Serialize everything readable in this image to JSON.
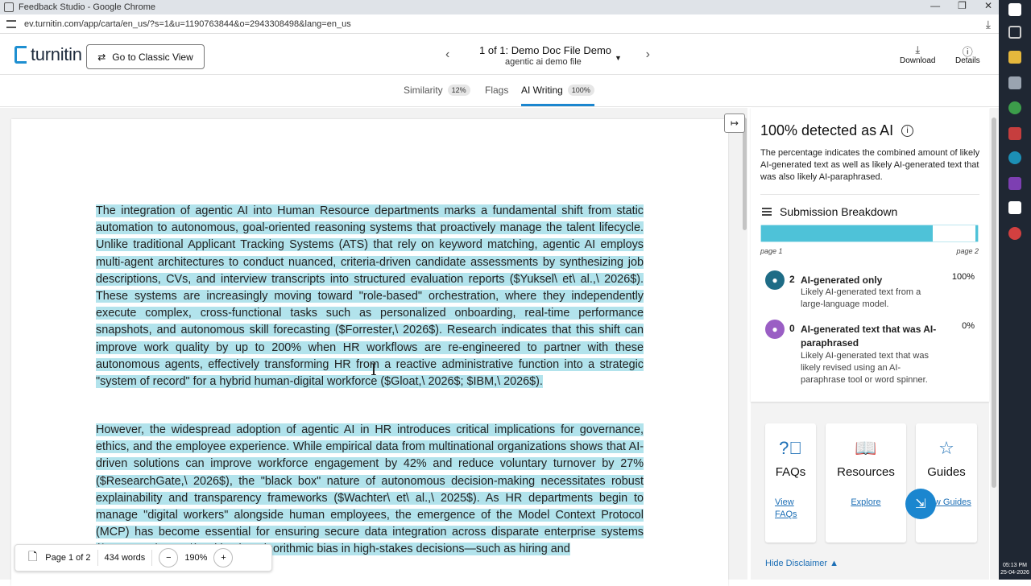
{
  "window": {
    "title": "Feedback Studio - Google Chrome",
    "url": "ev.turnitin.com/app/carta/en_us/?s=1&u=1190763844&o=2943308498&lang=en_us"
  },
  "header": {
    "logo": "turnitin",
    "classic_label": "Go to Classic View",
    "doc_title": "1 of 1: Demo Doc File Demo",
    "doc_subtitle": "agentic ai demo file",
    "download_label": "Download",
    "details_label": "Details"
  },
  "tabs": [
    {
      "label": "Similarity",
      "badge": "12%"
    },
    {
      "label": "Flags",
      "badge": ""
    },
    {
      "label": "AI Writing",
      "badge": "100%"
    }
  ],
  "document": {
    "para1": "The integration of agentic AI into Human Resource departments marks a fundamental shift from static automation to autonomous, goal-oriented reasoning systems that proactively manage the talent lifecycle. Unlike traditional Applicant Tracking Systems (ATS) that rely on keyword matching, agentic AI employs multi-agent architectures to conduct nuanced, criteria-driven candidate assessments by synthesizing job descriptions, CVs, and interview transcripts into structured evaluation reports ($Yuksel\\ et\\ al.,\\ 2026$). These systems are increasingly moving toward \"role-based\" orchestration, where they independently execute complex, cross-functional tasks such as personalized onboarding, real-time performance snapshots, and autonomous skill forecasting ($Forrester,\\ 2026$). Research indicates that this shift can improve work quality by up to 200% when HR workflows are re-engineered to partner with these autonomous agents, effectively transforming HR from a reactive administrative function into a strategic \"system of record\" for a hybrid human-digital workforce ($Gloat,\\ 2026$; $IBM,\\ 2026$).",
    "para2": "However, the widespread adoption of agentic AI in HR introduces critical implications for governance, ethics, and the employee experience. While empirical data from multinational organizations shows that AI-driven solutions can improve workforce engagement by 42% and reduce voluntary turnover by 27% ($ResearchGate,\\ 2026$), the \"black box\" nature of autonomous decision-making necessitates robust explainability and transparency frameworks ($Wachter\\ et\\ al.,\\ 2025$). As HR departments begin to manage \"digital workers\" alongside human employees, the emergence of the Model Context Protocol (MCP) has become essential for ensuring secure data integration across disparate enterprise systems ($Forrester,\\ 2026$). Mitigating algorithmic bias in high-stakes decisions—such as hiring and"
  },
  "footer": {
    "page": "Page 1 of 2",
    "words": "434 words",
    "zoom": "190%"
  },
  "panel": {
    "title": "100% detected as AI",
    "desc": "The percentage indicates the combined amount of likely AI-generated text as well as likely AI-generated text that was also likely AI-paraphrased.",
    "breakdown_title": "Submission Breakdown",
    "bar_fraction": 0.79,
    "page_start": "page 1",
    "page_end": "page 2",
    "items": [
      {
        "count": "2",
        "label": "AI-generated only",
        "pct": "100%",
        "sub": "Likely AI-generated text from a large-language model.",
        "color": "#1e6c86"
      },
      {
        "count": "0",
        "label": "AI-generated text that was AI-paraphrased",
        "pct": "0%",
        "sub": "Likely AI-generated text that was likely revised using an AI-paraphrase tool or word spinner.",
        "color": "#9a5ec4"
      }
    ],
    "resources": [
      {
        "title": "FAQs",
        "link": "View FAQs"
      },
      {
        "title": "Resources",
        "link": "Explore"
      },
      {
        "title": "Guides",
        "link": "View Guides"
      }
    ],
    "hide_disclaimer": "Hide Disclaimer"
  },
  "taskbar": {
    "time": "05:13 PM",
    "date": "25-04-2026"
  }
}
